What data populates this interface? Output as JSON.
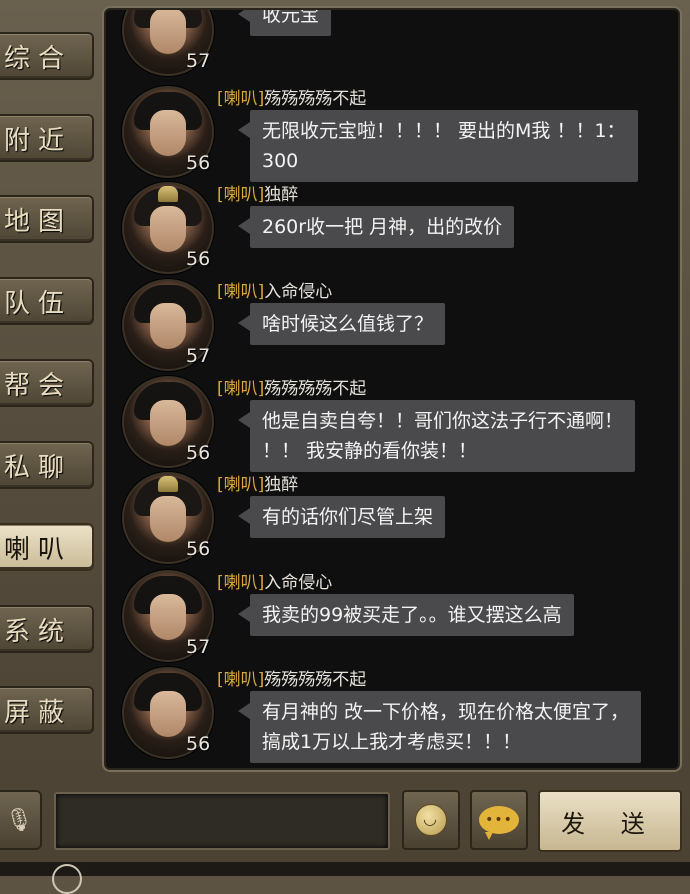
{
  "tabs": [
    {
      "label": "综合",
      "active": false
    },
    {
      "label": "附近",
      "active": false
    },
    {
      "label": "地图",
      "active": false
    },
    {
      "label": "队伍",
      "active": false
    },
    {
      "label": "帮会",
      "active": false
    },
    {
      "label": "私聊",
      "active": false
    },
    {
      "label": "喇叭",
      "active": true
    },
    {
      "label": "系统",
      "active": false
    },
    {
      "label": "屏蔽",
      "active": false
    }
  ],
  "messages": [
    {
      "tag": "",
      "name": "",
      "level": "57",
      "avatar": "female-icon",
      "text": "收元宝"
    },
    {
      "tag": "[喇叭]",
      "name": "殇殇殇殇不起",
      "level": "56",
      "avatar": "male-icon",
      "text": "无限收元宝啦！！！！ 要出的M我 ！！1：\n300"
    },
    {
      "tag": "[喇叭]",
      "name": "独醉",
      "level": "56",
      "avatar": "female-icon",
      "text": "260r收一把 月神，出的改价"
    },
    {
      "tag": "[喇叭]",
      "name": "入命侵心",
      "level": "57",
      "avatar": "male-longhair-icon",
      "text": "啥时候这么值钱了？"
    },
    {
      "tag": "[喇叭]",
      "name": "殇殇殇殇不起",
      "level": "56",
      "avatar": "male-icon",
      "text": "他是自卖自夸！！哥们你这法子行不通啊！\n！！ 我安静的看你装！！"
    },
    {
      "tag": "[喇叭]",
      "name": "独醉",
      "level": "56",
      "avatar": "female-icon",
      "text": "有的话你们尽管上架"
    },
    {
      "tag": "[喇叭]",
      "name": "入命侵心",
      "level": "57",
      "avatar": "male-longhair-icon",
      "text": "我卖的99被买走了。。谁又摆这么高"
    },
    {
      "tag": "[喇叭]",
      "name": "殇殇殇殇不起",
      "level": "56",
      "avatar": "male-icon",
      "text": "有月神的 改一下价格，现在价格太便宜了，\n搞成1万以上我才考虑买！！！"
    }
  ],
  "bottom": {
    "send_label": "发 送",
    "voice_icon": "microphone-icon",
    "emoji_icon": "smiley-icon",
    "quick_chat_icon": "chat-bubble-icon",
    "quick_chat_text": "•••"
  },
  "colors": {
    "accent_tag": "#d9a83a",
    "bubble": "#4a4a4c",
    "panel": "#0f0f10"
  }
}
